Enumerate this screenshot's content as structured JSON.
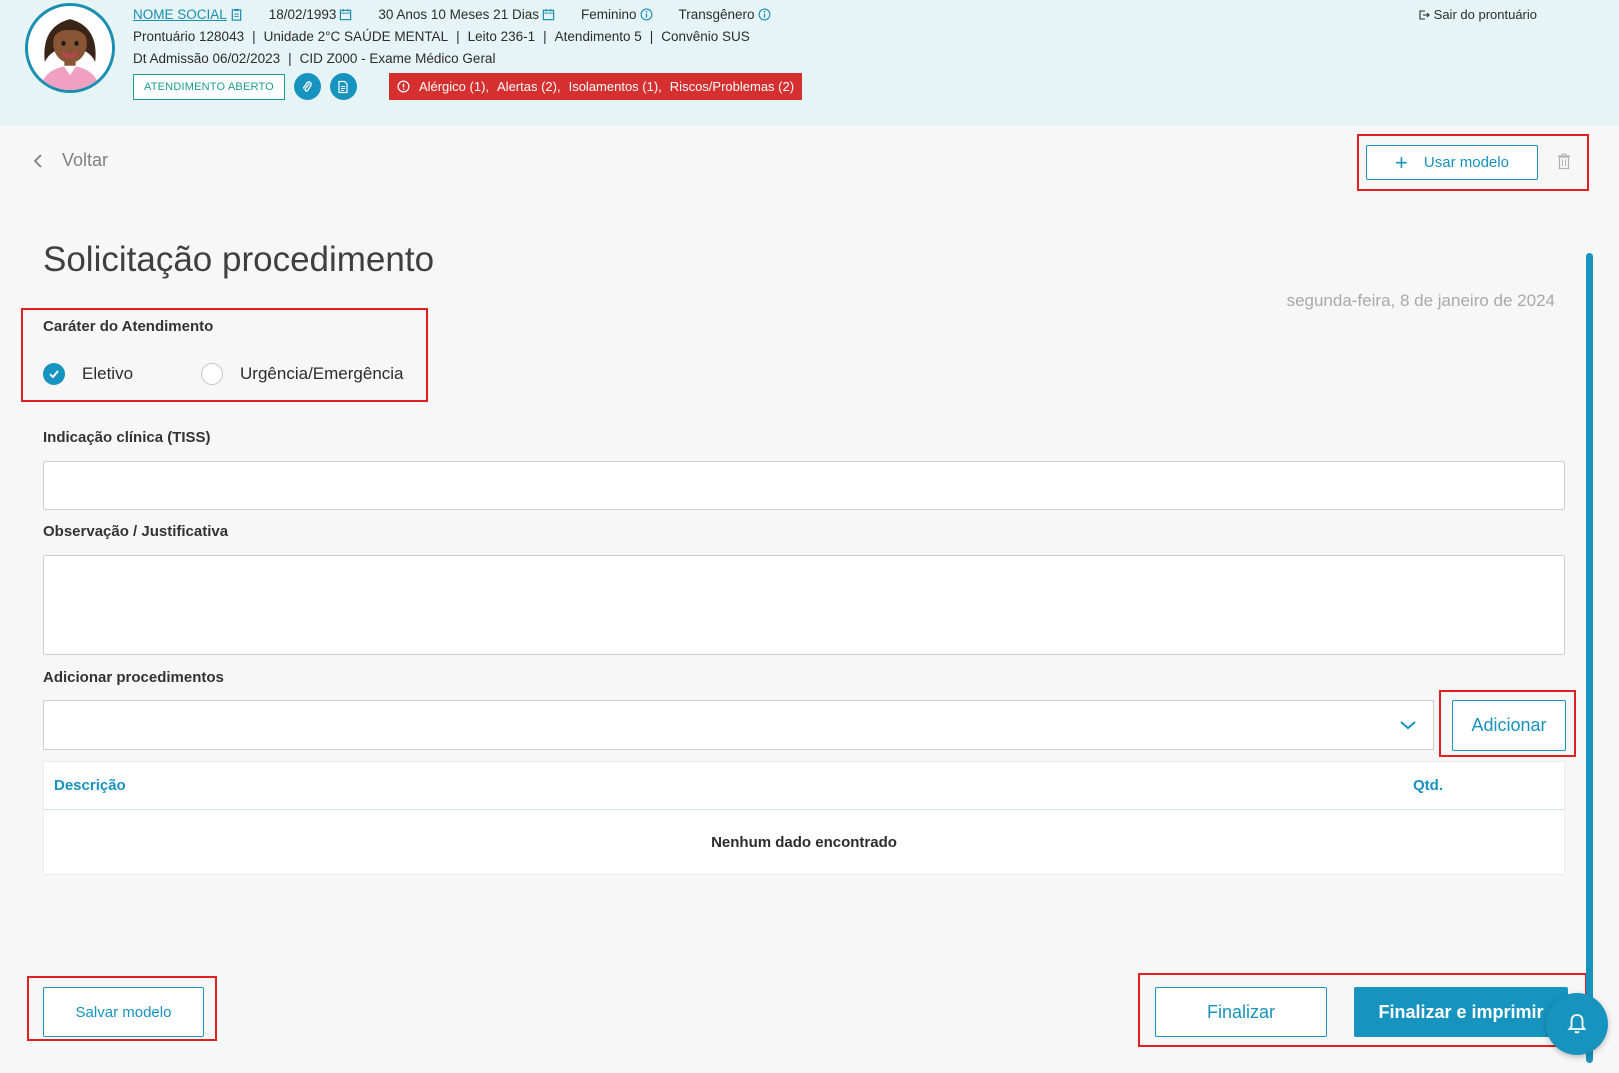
{
  "patient": {
    "social_name": "NOME SOCIAL",
    "birth_date": "18/02/1993",
    "age": "30 Anos 10 Meses 21 Dias",
    "sex": "Feminino",
    "gender": "Transgênero",
    "record": "Prontuário 128043",
    "unit": "Unidade 2°C SAÚDE MENTAL",
    "bed": "Leito 236-1",
    "attendance": "Atendimento 5",
    "insurance": "Convênio SUS",
    "admission": "Dt Admissão 06/02/2023",
    "cid": "CID Z000 - Exame Médico Geral",
    "status_badge": "ATENDIMENTO ABERTO",
    "alerts": [
      "Alérgico (1),",
      "Alertas (2),",
      "Isolamentos (1),",
      "Riscos/Problemas (2)"
    ],
    "separator": "|"
  },
  "header": {
    "exit_label": "Sair do prontuário"
  },
  "toolbar": {
    "back_label": "Voltar",
    "use_model_plus": "+",
    "use_model_label": "Usar modelo"
  },
  "form": {
    "title": "Solicitação procedimento",
    "date": "segunda-feira, 8 de janeiro de 2024",
    "character_label": "Caráter do Atendimento",
    "options": [
      {
        "label": "Eletivo",
        "checked": true
      },
      {
        "label": "Urgência/Emergência",
        "checked": false
      }
    ],
    "clinical_label": "Indicação clínica (TISS)",
    "clinical_value": "",
    "observation_label": "Observação / Justificativa",
    "observation_value": "",
    "procedures_label": "Adicionar procedimentos",
    "add_label": "Adicionar"
  },
  "table": {
    "columns": [
      "Descrição",
      "Qtd."
    ],
    "empty_message": "Nenhum dado encontrado"
  },
  "footer": {
    "save_model_label": "Salvar modelo",
    "finalize_label": "Finalizar",
    "finalize_print_label": "Finalizar e imprimir"
  },
  "colors": {
    "primary": "#1793c0",
    "header_bg": "#e6f4f6",
    "alert_bg": "#d62f2f",
    "annotation_box": "#e02020"
  },
  "icons": [
    "calendar-icon",
    "info-icon",
    "clipboard-icon",
    "attachment-icon",
    "document-icon",
    "alert-icon",
    "exit-icon",
    "chevron-left-icon",
    "trash-icon",
    "chevron-down-icon",
    "check-icon",
    "bell-icon"
  ]
}
